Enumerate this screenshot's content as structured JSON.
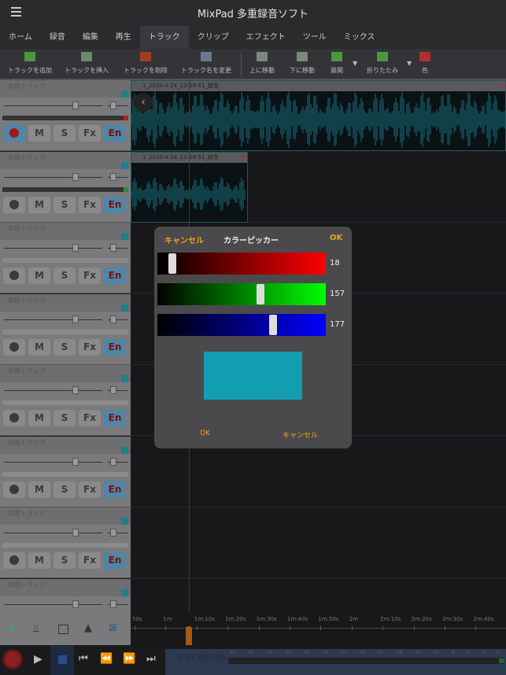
{
  "app": {
    "title": "MixPad 多重録音ソフト"
  },
  "tabs": [
    {
      "label": "ホーム"
    },
    {
      "label": "録音"
    },
    {
      "label": "編集"
    },
    {
      "label": "再生"
    },
    {
      "label": "トラック",
      "active": true
    },
    {
      "label": "クリップ"
    },
    {
      "label": "エフェクト"
    },
    {
      "label": "ツール"
    },
    {
      "label": "ミックス"
    }
  ],
  "toolbar": [
    {
      "label": "トラックを追加",
      "icon": "add-track-icon"
    },
    {
      "label": "トラックを挿入",
      "icon": "insert-track-icon"
    },
    {
      "label": "トラックを削除",
      "icon": "delete-track-icon"
    },
    {
      "label": "トラック名を変更",
      "icon": "rename-track-icon"
    },
    {
      "label": "上に移動",
      "icon": "move-up-icon"
    },
    {
      "label": "下に移動",
      "icon": "move-down-icon"
    },
    {
      "label": "展開",
      "icon": "expand-icon"
    },
    {
      "label": "折りたたみ",
      "icon": "collapse-icon"
    },
    {
      "label": "色",
      "icon": "color-icon"
    }
  ],
  "track_name": "無題トラック",
  "track_buttons": {
    "mute": "M",
    "solo": "S",
    "fx": "Fx",
    "en": "En"
  },
  "clips": [
    {
      "name": "1_2020-4-24_13-28-51_録音"
    },
    {
      "name": "1_2020-4-24_13-28-51_録音"
    }
  ],
  "ruler": [
    "50s",
    "1m",
    "1m:10s",
    "1m:20s",
    "1m:30s",
    "1m:40s",
    "1m:50s",
    "2m",
    "2m:10s",
    "2m:20s",
    "2m:30s",
    "2m:40s"
  ],
  "transport": {
    "time": "0:01:08.586",
    "meter_ticks": [
      "-45",
      "-42",
      "-39",
      "-36",
      "-33",
      "-30",
      "-27",
      "-24",
      "-21",
      "-18",
      "-15",
      "-12",
      "-9",
      "-6",
      "-3",
      "0"
    ]
  },
  "color_picker": {
    "title": "カラーピッカー",
    "cancel_top": "キャンセル",
    "ok_top": "OK",
    "ok_bottom": "OK",
    "cancel_bottom": "キャンセル",
    "r": 18,
    "g": 157,
    "b": 177,
    "preview_color": "#129db1"
  }
}
